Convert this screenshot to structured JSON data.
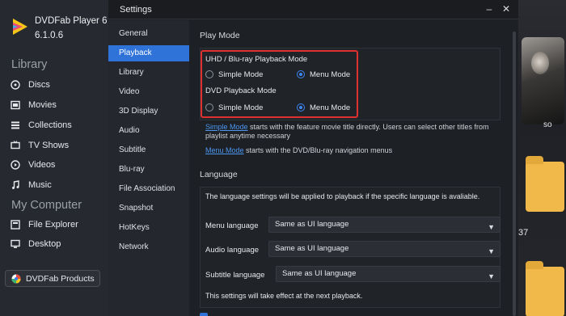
{
  "app": {
    "name": "DVDFab Player 6",
    "version": "6.1.0.6",
    "library_title": "Library",
    "library_items": [
      {
        "label": "Discs",
        "icon": "disc-icon"
      },
      {
        "label": "Movies",
        "icon": "movie-icon"
      },
      {
        "label": "Collections",
        "icon": "collections-icon"
      },
      {
        "label": "TV Shows",
        "icon": "tv-icon"
      },
      {
        "label": "Videos",
        "icon": "video-icon"
      },
      {
        "label": "Music",
        "icon": "music-icon"
      }
    ],
    "computer_title": "My Computer",
    "computer_items": [
      {
        "label": "File Explorer",
        "icon": "file-explorer-icon"
      },
      {
        "label": "Desktop",
        "icon": "desktop-icon"
      }
    ],
    "products_label": "DVDFab Products"
  },
  "background": {
    "poster_label": "so",
    "partial_number": "37"
  },
  "dialog": {
    "title": "Settings",
    "minimize": "–",
    "close": "✕",
    "nav": [
      "General",
      "Playback",
      "Library",
      "Video",
      "3D Display",
      "Audio",
      "Subtitle",
      "Blu-ray",
      "File Association",
      "Snapshot",
      "HotKeys",
      "Network"
    ],
    "active_nav": "Playback"
  },
  "playback": {
    "section_title": "Play Mode",
    "uhd_title": "UHD / Blu-ray Playback Mode",
    "dvd_title": "DVD Playback Mode",
    "simple_label": "Simple Mode",
    "menu_label": "Menu Mode",
    "uhd_selected": "Menu Mode",
    "dvd_selected": "Menu Mode",
    "simple_link": "Simple Mode",
    "simple_desc": " starts with the feature movie title directly. Users can select other titles from playlist anytime necessary",
    "menu_link": "Menu Mode",
    "menu_desc": " starts with the DVD/Blu-ray navigation menus"
  },
  "language": {
    "section_title": "Language",
    "note": "The language settings will be applied to playback if the specific language is avaliable.",
    "menu_label": "Menu language",
    "audio_label": "Audio language",
    "subtitle_label": "Subtitle language",
    "menu_value": "Same as UI language",
    "audio_value": "Same as UI language",
    "subtitle_value": "Same as UI language",
    "footer": "This settings will take effect at the next playback."
  },
  "colors": {
    "accent": "#2f73d8",
    "highlight_border": "#e03030",
    "link": "#4c97f0"
  }
}
